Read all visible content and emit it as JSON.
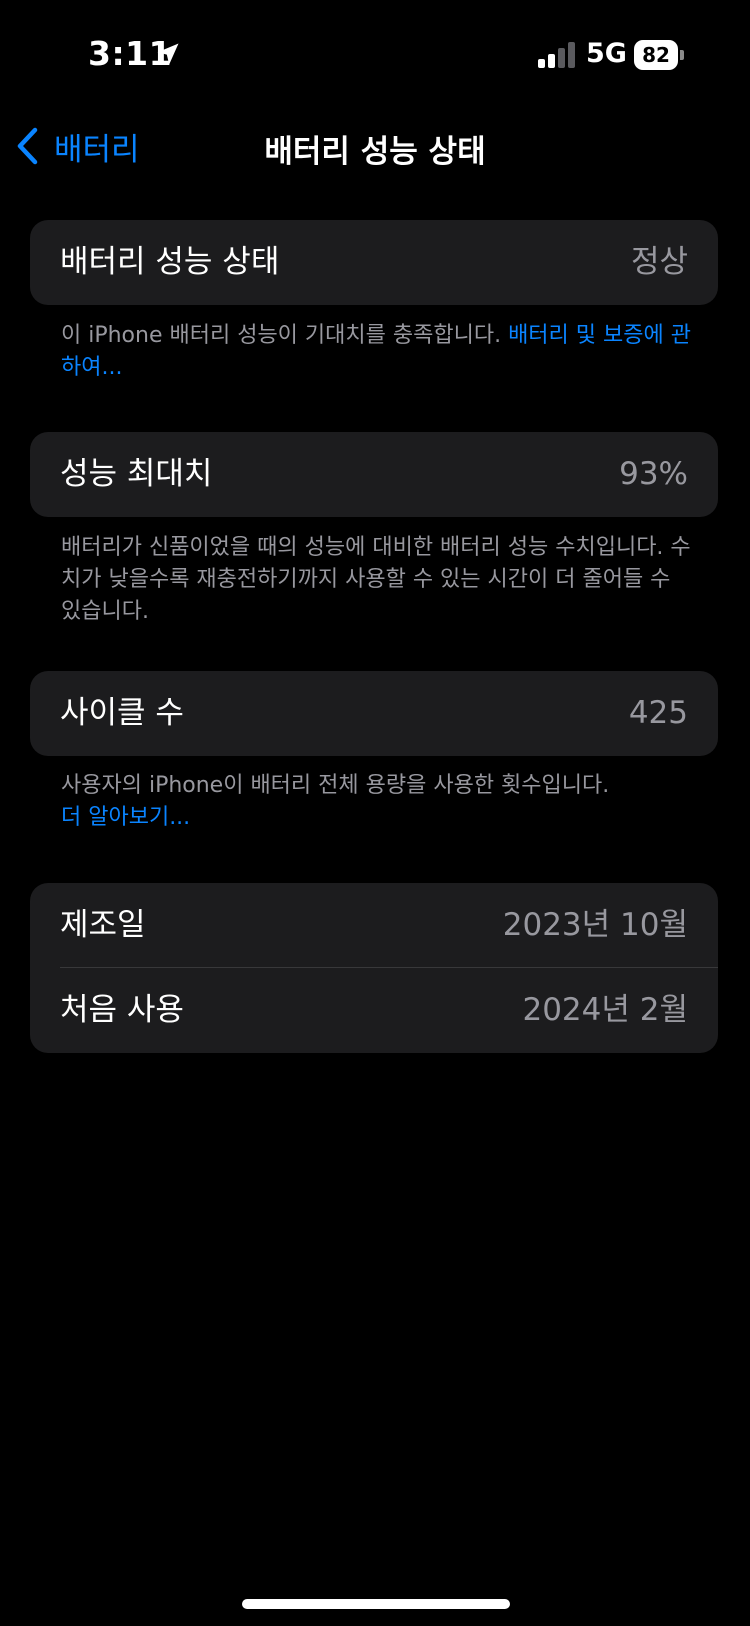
{
  "status_bar": {
    "time": "3:11",
    "network": "5G",
    "battery_level": "82"
  },
  "nav": {
    "back_label": "배터리",
    "title": "배터리 성능 상태"
  },
  "health_section": {
    "label": "배터리 성능 상태",
    "value": "정상",
    "footnote_text": "이 iPhone 배터리 성능이 기대치를 충족합니다. ",
    "footnote_link": "배터리 및 보증에 관하여..."
  },
  "capacity_section": {
    "label": "성능 최대치",
    "value": "93%",
    "footnote_text": "배터리가 신품이었을 때의 성능에 대비한 배터리 성능 수치입니다. 수치가 낮을수록 재충전하기까지 사용할 수 있는 시간이 더 줄어들 수 있습니다."
  },
  "cycle_section": {
    "label": "사이클 수",
    "value": "425",
    "footnote_text": "사용자의 iPhone이 배터리 전체 용량을 사용한 횟수입니다.",
    "footnote_link": "더 알아보기..."
  },
  "date_section": {
    "manufactured_label": "제조일",
    "manufactured_value": "2023년 10월",
    "first_use_label": "처음 사용",
    "first_use_value": "2024년 2월"
  },
  "colors": {
    "accent": "#0a84ff",
    "background": "#000000",
    "card": "#1c1c1e",
    "secondary_text": "#98989f"
  }
}
